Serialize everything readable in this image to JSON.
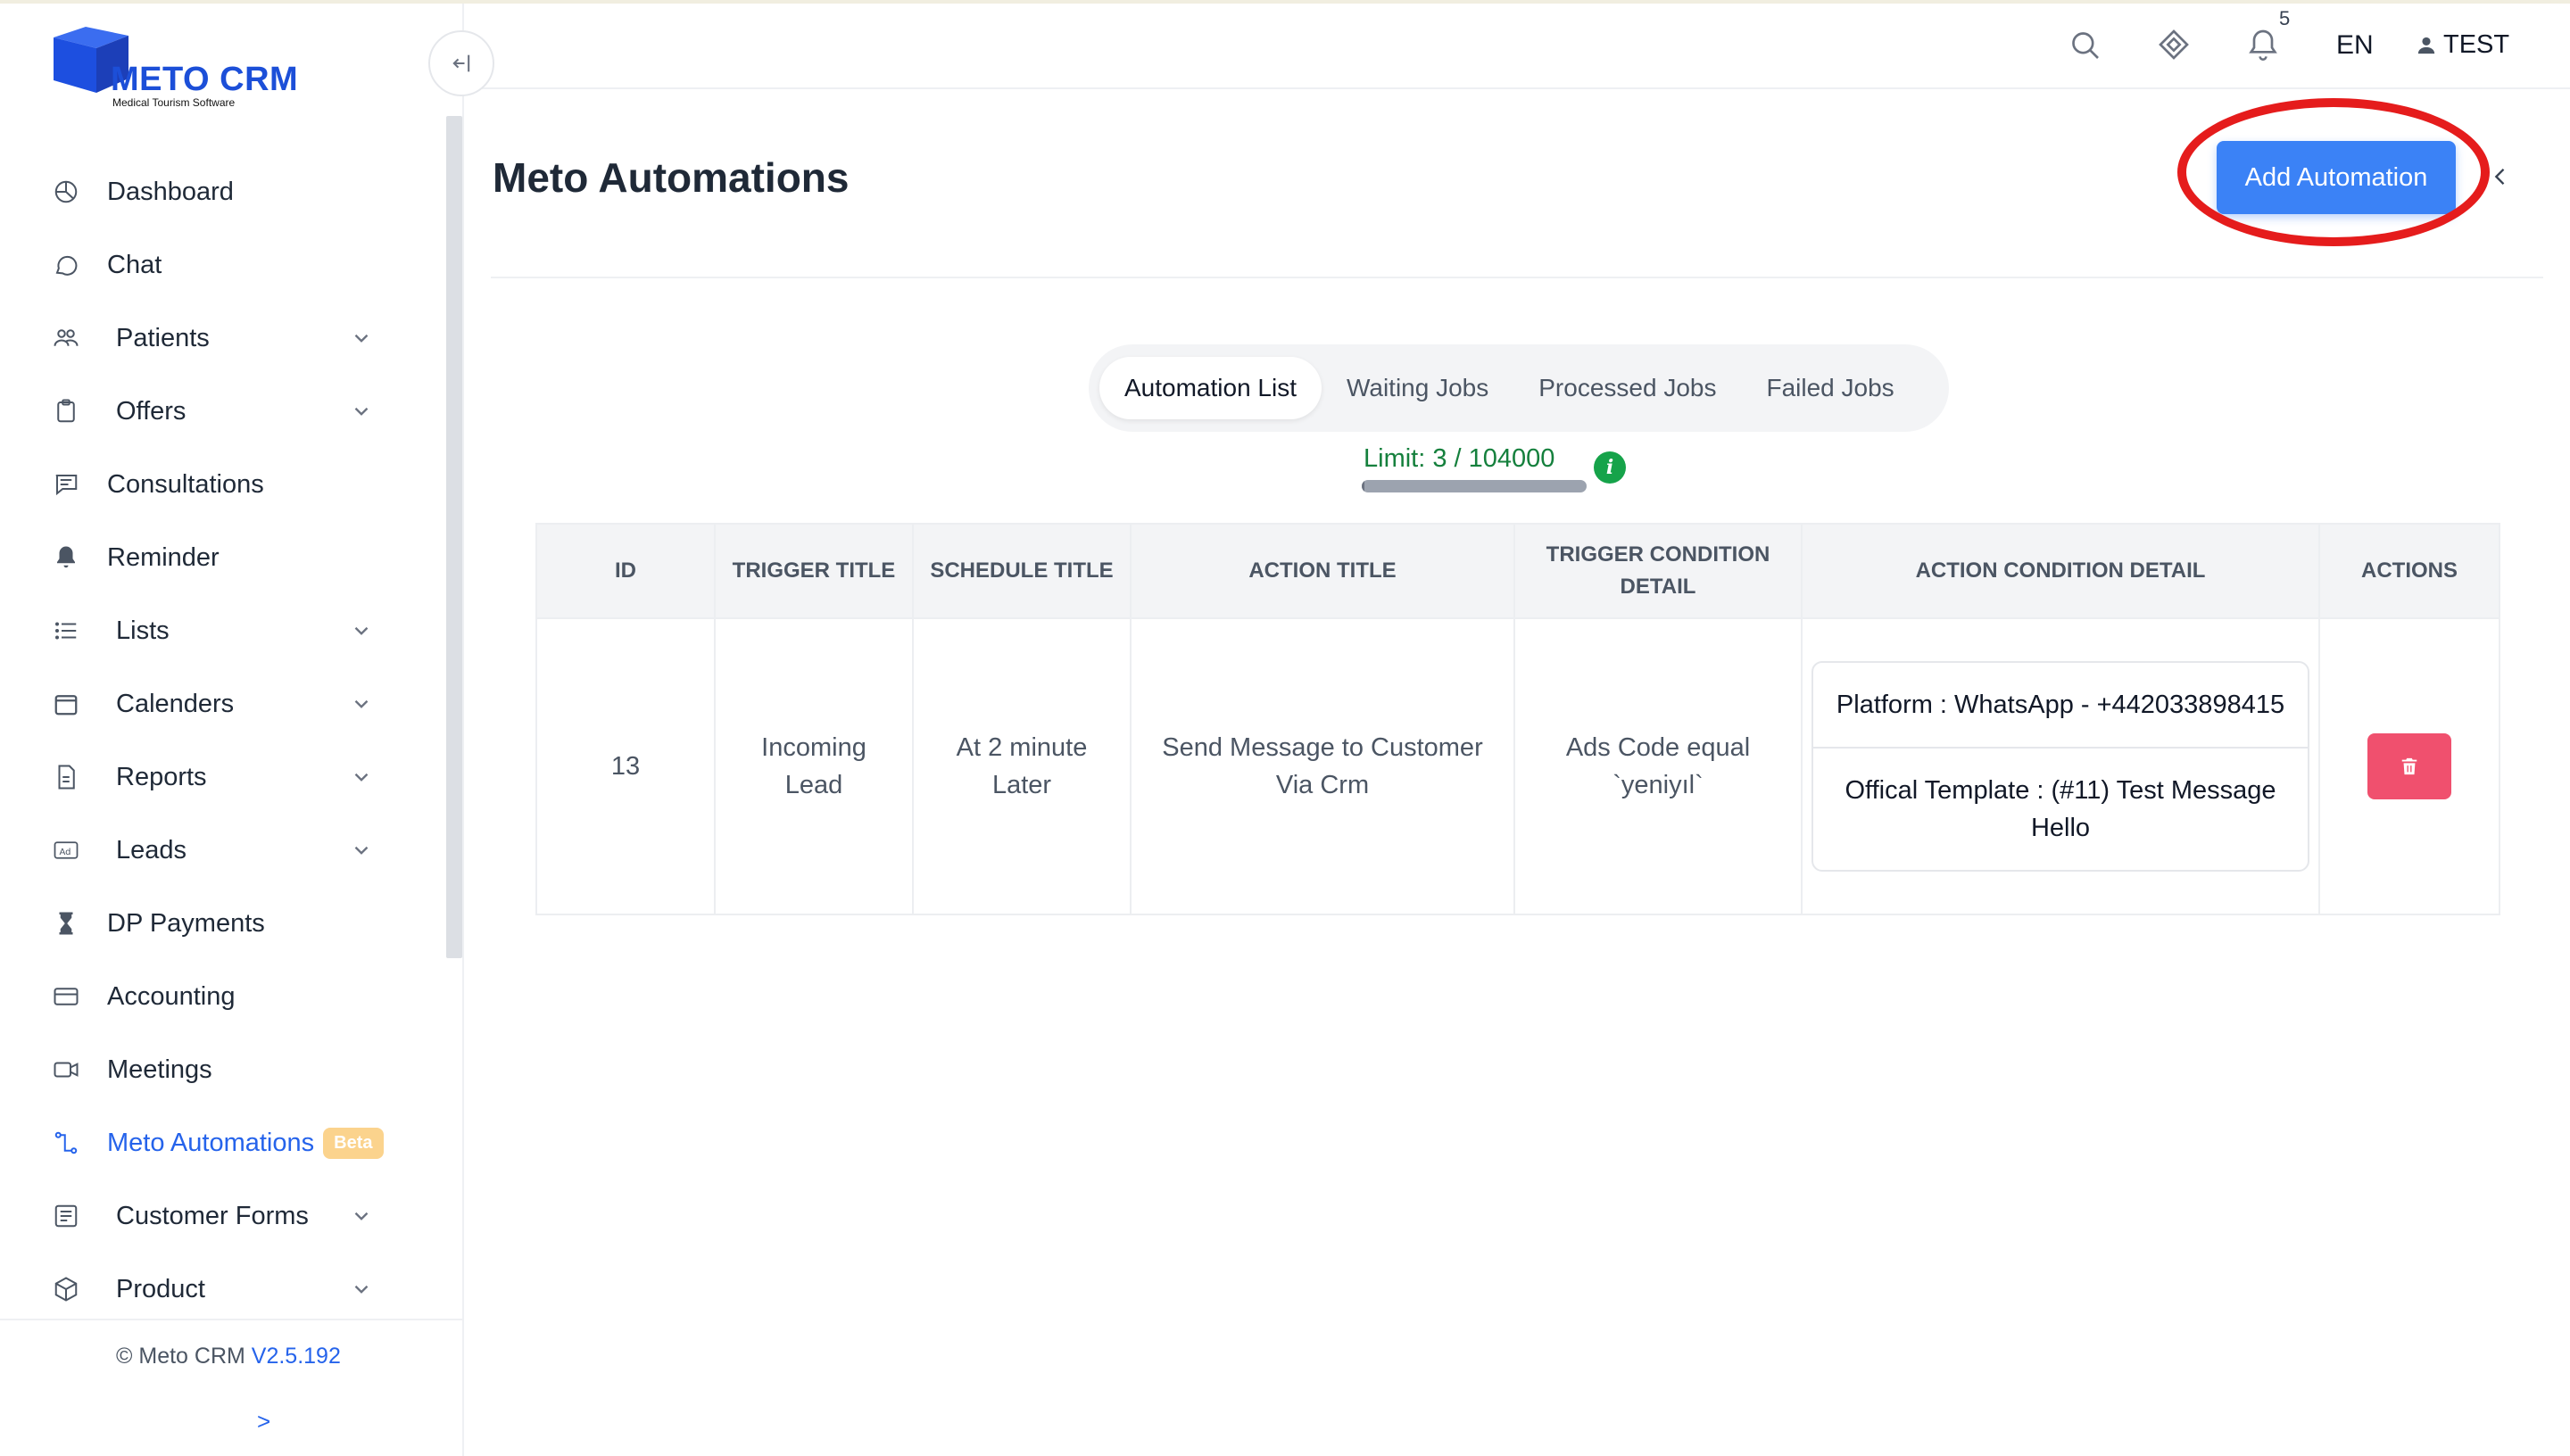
{
  "brand": {
    "name": "METO CRM",
    "tagline": "Medical Tourism Software",
    "color": "#1c4fd8"
  },
  "sidebar": {
    "collapse_icon": "collapse-left-icon",
    "items": [
      {
        "label": "Dashboard",
        "icon": "dashboard-icon",
        "has_sub": false
      },
      {
        "label": "Chat",
        "icon": "chat-icon",
        "has_sub": false
      },
      {
        "label": "Patients",
        "icon": "users-icon",
        "has_sub": true
      },
      {
        "label": "Offers",
        "icon": "clipboard-icon",
        "has_sub": true
      },
      {
        "label": "Consultations",
        "icon": "message-icon",
        "has_sub": false
      },
      {
        "label": "Reminder",
        "icon": "bell-icon",
        "has_sub": false
      },
      {
        "label": "Lists",
        "icon": "list-icon",
        "has_sub": true
      },
      {
        "label": "Calenders",
        "icon": "calendar-icon",
        "has_sub": true
      },
      {
        "label": "Reports",
        "icon": "report-icon",
        "has_sub": true
      },
      {
        "label": "Leads",
        "icon": "ad-icon",
        "has_sub": true
      },
      {
        "label": "DP Payments",
        "icon": "hourglass-icon",
        "has_sub": false
      },
      {
        "label": "Accounting",
        "icon": "card-icon",
        "has_sub": false
      },
      {
        "label": "Meetings",
        "icon": "video-icon",
        "has_sub": false
      },
      {
        "label": "Meto Automations",
        "icon": "automation-icon",
        "has_sub": false,
        "active": true,
        "badge": "Beta"
      },
      {
        "label": "Customer Forms",
        "icon": "form-icon",
        "has_sub": true
      },
      {
        "label": "Product",
        "icon": "box-icon",
        "has_sub": true
      }
    ],
    "footer": {
      "copyright": "© Meto CRM",
      "version": "V2.5.192",
      "expand": ">"
    }
  },
  "header": {
    "notification_count": "5",
    "language": "EN",
    "user": "TEST"
  },
  "page": {
    "title": "Meto Automations",
    "add_button": "Add Automation",
    "tabs": [
      "Automation List",
      "Waiting Jobs",
      "Processed Jobs",
      "Failed Jobs"
    ],
    "active_tab": 0,
    "limit_text": "Limit: 3 / 104000",
    "limit_fraction": 3e-05
  },
  "table": {
    "columns": [
      "ID",
      "TRIGGER TITLE",
      "SCHEDULE TITLE",
      "ACTION TITLE",
      "TRIGGER CONDITION DETAIL",
      "ACTION CONDITION DETAIL",
      "ACTIONS"
    ],
    "rows": [
      {
        "id": "13",
        "trigger_title": "Incoming Lead",
        "schedule_title": "At 2 minute Later",
        "action_title": "Send Message to Customer Via Crm",
        "trigger_condition": "Ads Code equal `yeniyıl`",
        "action_conditions": [
          "Platform : WhatsApp - +442033898415",
          "Offical Template : (#11) Test Message Hello"
        ]
      }
    ]
  },
  "colors": {
    "accent": "#3b82f6",
    "active_nav": "#2563eb",
    "limit": "#15803d",
    "delete": "#f0506e",
    "highlight": "#e51c1c"
  }
}
